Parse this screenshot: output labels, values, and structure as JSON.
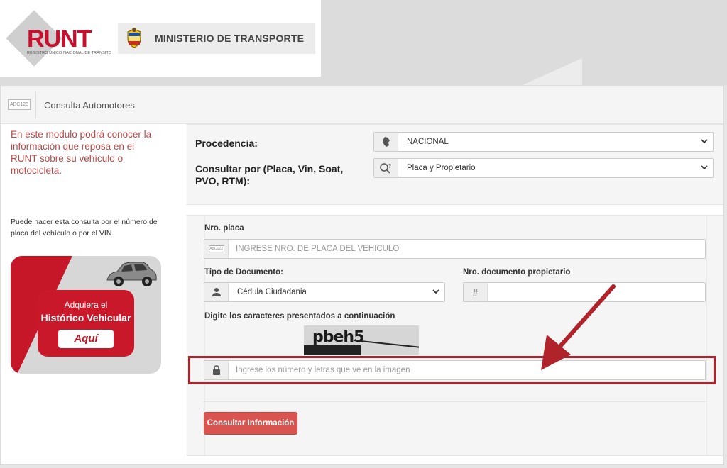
{
  "header": {
    "runt_logo": "RUNT",
    "runt_tagline": "REGISTRO ÚNICO NACIONAL DE TRÁNSITO",
    "ministerio": "MINISTERIO DE TRANSPORTE"
  },
  "titlebar": {
    "icon_text": "ABC123",
    "title": "Consulta Automotores"
  },
  "sidebar": {
    "intro": "En este modulo podrá conocer la información que reposa en el RUNT sobre su vehículo o motocicleta.",
    "hint": "Puede hacer esta consulta por el número de placa del vehículo o por el VIN.",
    "banner": {
      "line1": "Adquiera el",
      "line2": "Histórico Vehicular",
      "button": "Aquí"
    }
  },
  "form": {
    "procedencia_label": "Procedencia:",
    "procedencia_value": "NACIONAL",
    "consultar_por_label": "Consultar por (Placa, Vin, Soat, PVO, RTM):",
    "consultar_por_value": "Placa y Propietario",
    "placa_label": "Nro. placa",
    "placa_placeholder": "INGRESE NRO. DE PLACA DEL VEHICULO",
    "tipo_doc_label": "Tipo de Documento:",
    "tipo_doc_value": "Cédula Ciudadania",
    "nro_doc_label": "Nro. documento propietario",
    "nro_doc_addon": "#",
    "captcha_label": "Digite los caracteres presentados a continuación",
    "captcha_text": "pbeh5",
    "captcha_placeholder": "Ingrese los número y letras que ve en la imagen",
    "submit_label": "Consultar Información"
  },
  "colors": {
    "brand_red": "#c8102e",
    "intro_text": "#b94a48",
    "button_red": "#d9534f",
    "highlight_red": "#b0232b"
  },
  "icons": {
    "procedencia": "colombia-map-icon",
    "consultar_por": "search-question-icon",
    "placa": "license-plate-icon",
    "tipo_doc": "user-icon",
    "captcha": "lock-icon"
  }
}
